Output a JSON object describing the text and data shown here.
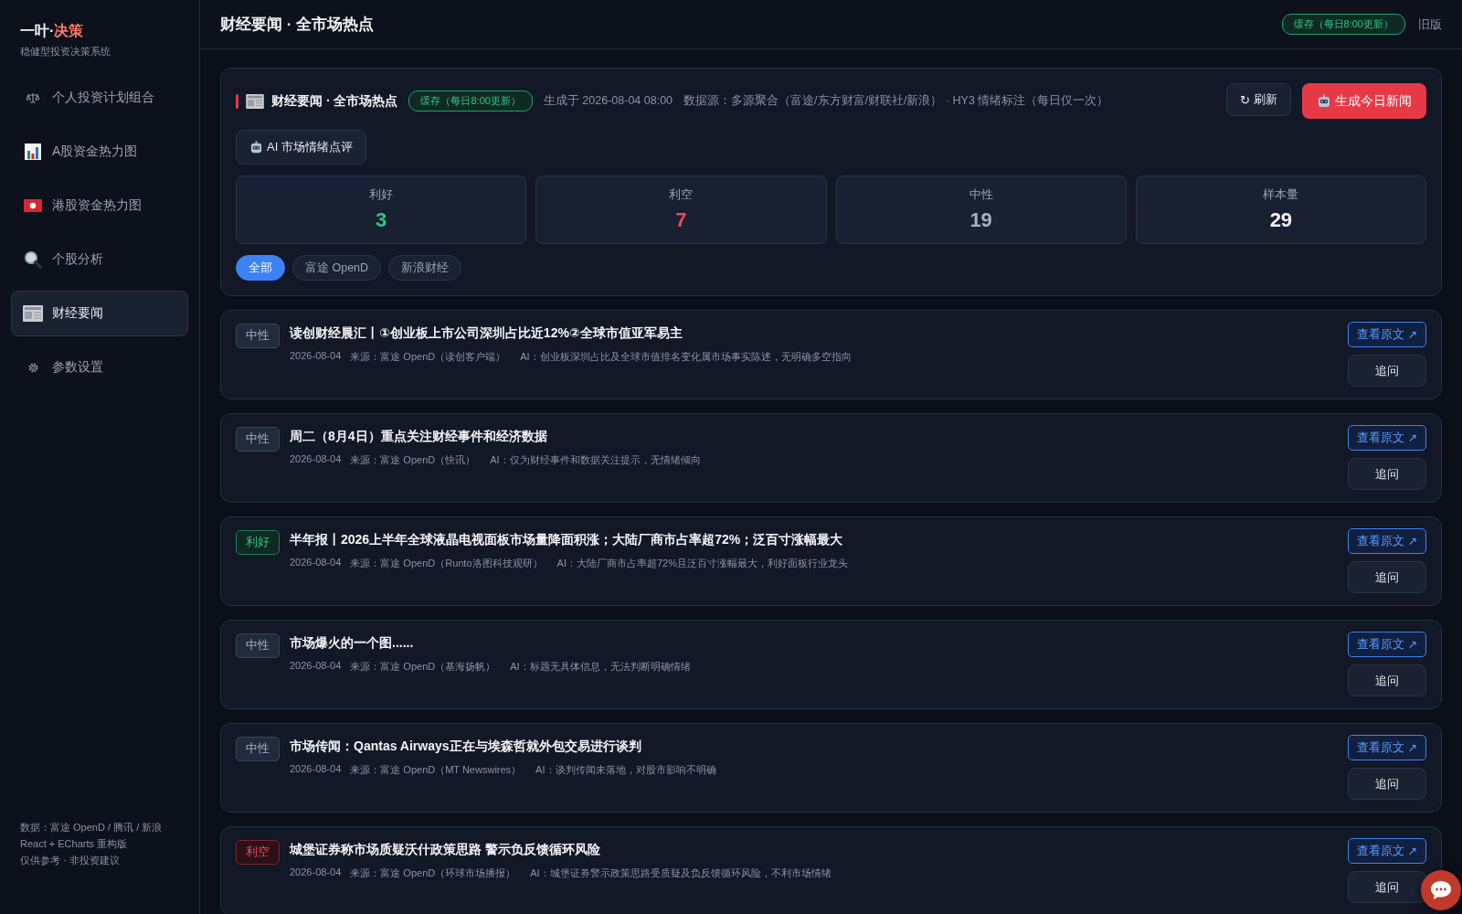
{
  "sidebar": {
    "brand": {
      "part_1": "一叶·",
      "part_2": "决策"
    },
    "subtitle": "稳健型投资决策系统",
    "items": [
      {
        "label": "个人投资计划组合",
        "selected": false
      },
      {
        "label": "A股资金热力图",
        "selected": false
      },
      {
        "label": "港股资金热力图",
        "selected": false
      },
      {
        "label": "个股分析",
        "selected": false
      },
      {
        "label": "财经要闻",
        "selected": true
      },
      {
        "label": "参数设置",
        "selected": false
      }
    ],
    "footer": [
      "数据：富途 OpenD / 腾讯 / 新浪",
      "React + ECharts 重构版",
      "仅供参考 · 非投资建议"
    ]
  },
  "header": {
    "title": "财经要闻 · 全市场热点",
    "cache_badge": "缓存（每日8:00更新）",
    "old_version_link": "旧版"
  },
  "summary": {
    "title": "财经要闻 · 全市场热点",
    "cache_badge": "缓存（每日8:00更新）",
    "generated": "生成于 2026-08-04 08:00",
    "source": "数据源：多源聚合（富途/东方财富/财联社/新浪） · HY3 情绪标注（每日仅一次）",
    "refresh_button": {
      "icon": "↻",
      "label": "刷新"
    },
    "generate_button": "生成今日新闻",
    "ai_button": "AI 市场情绪点评",
    "stats": [
      {
        "kind": "positive",
        "label": "利好",
        "value": "3"
      },
      {
        "kind": "negative",
        "label": "利空",
        "value": "7"
      },
      {
        "kind": "neutral",
        "label": "中性",
        "value": "19"
      },
      {
        "kind": "total",
        "label": "样本量",
        "value": "29"
      }
    ],
    "filters": [
      {
        "label": "全部",
        "selected": true
      },
      {
        "label": "富途 OpenD",
        "selected": false
      },
      {
        "label": "新浪财经",
        "selected": false
      }
    ]
  },
  "news": [
    {
      "kind": "neutral",
      "tag": "中性",
      "title": "读创财经晨汇丨①创业板上市公司深圳占比近12%②全球市值亚军易主",
      "date": "2026-08-04",
      "source": "来源：富途 OpenD（读创客户端）",
      "ai": "AI：创业板深圳占比及全球市值排名变化属市场事实陈述，无明确多空指向",
      "open_link": "查看原文 ↗",
      "ask_button": "追问"
    },
    {
      "kind": "neutral",
      "tag": "中性",
      "title": "周二（8月4日）重点关注财经事件和经济数据",
      "date": "2026-08-04",
      "source": "来源：富途 OpenD（快讯）",
      "ai": "AI：仅为财经事件和数据关注提示，无情绪倾向",
      "open_link": "查看原文 ↗",
      "ask_button": "追问"
    },
    {
      "kind": "positive",
      "tag": "利好",
      "title": "半年报丨2026上半年全球液晶电视面板市场量降面积涨；大陆厂商市占率超72%；泛百寸涨幅最大",
      "date": "2026-08-04",
      "source": "来源：富途 OpenD（Runto洛图科技观研）",
      "ai": "AI：大陆厂商市占率超72%且泛百寸涨幅最大，利好面板行业龙头",
      "open_link": "查看原文 ↗",
      "ask_button": "追问"
    },
    {
      "kind": "neutral",
      "tag": "中性",
      "title": "市场爆火的一个图......",
      "date": "2026-08-04",
      "source": "来源：富途 OpenD（基海扬帆）",
      "ai": "AI：标题无具体信息，无法判断明确情绪",
      "open_link": "查看原文 ↗",
      "ask_button": "追问"
    },
    {
      "kind": "neutral",
      "tag": "中性",
      "title": "市场传闻：Qantas Airways正在与埃森哲就外包交易进行谈判",
      "date": "2026-08-04",
      "source": "来源：富途 OpenD（MT Newswires）",
      "ai": "AI：谈判传闻未落地，对股市影响不明确",
      "open_link": "查看原文 ↗",
      "ask_button": "追问"
    },
    {
      "kind": "negative",
      "tag": "利空",
      "title": "城堡证券称市场质疑沃什政策思路 警示负反馈循环风险",
      "date": "2026-08-04",
      "source": "来源：富途 OpenD（环球市场播报）",
      "ai": "AI：城堡证券警示政策思路受质疑及负反馈循环风险，不利市场情绪",
      "open_link": "查看原文 ↗",
      "ask_button": "追问"
    }
  ]
}
